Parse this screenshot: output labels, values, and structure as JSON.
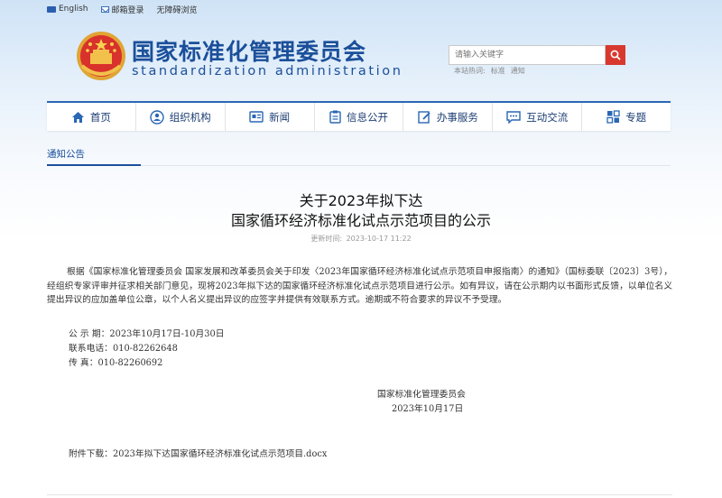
{
  "topbar": {
    "english": "English",
    "mail_login": "邮箱登录",
    "accessible": "无障碍浏览"
  },
  "header": {
    "title": "国家标准化管理委员会",
    "subtitle": "standardization administration"
  },
  "search": {
    "placeholder": "请输入关键字",
    "hot_label": "本站热词:",
    "hot_words": [
      "标准",
      "通知"
    ]
  },
  "nav": {
    "items": [
      {
        "label": "首页",
        "icon": "home-icon"
      },
      {
        "label": "组织机构",
        "icon": "org-icon"
      },
      {
        "label": "新闻",
        "icon": "news-icon"
      },
      {
        "label": "信息公开",
        "icon": "info-icon"
      },
      {
        "label": "办事服务",
        "icon": "service-icon"
      },
      {
        "label": "互动交流",
        "icon": "chat-icon"
      },
      {
        "label": "专题",
        "icon": "topic-icon"
      }
    ]
  },
  "breadcrumb": "通知公告",
  "article": {
    "title_line1": "关于2023年拟下达",
    "title_line2": "国家循环经济标准化试点示范项目的公示",
    "meta_label": "更新时间:",
    "meta_time": "2023-10-17 11:22",
    "paragraph": "根据《国家标准化管理委员会 国家发展和改革委员会关于印发〈2023年国家循环经济标准化试点示范项目申报指南〉的通知》（国标委联〔2023〕3号），经组织专家评审并征求相关部门意见，现将2023年拟下达的国家循环经济标准化试点示范项目进行公示。如有异议，请在公示期内以书面形式反馈，以单位名义提出异议的应加盖单位公章，以个人名义提出异议的应签字并提供有效联系方式。逾期或不符合要求的异议不予受理。",
    "period": "公 示 期：2023年10月17日-10月30日",
    "phone": "联系电话：010-82262648",
    "fax": "传  真：010-82260692",
    "sign_org": "国家标准化管理委员会",
    "sign_date": "2023年10月17日",
    "attach_label": "附件下载：",
    "attach_file": "2023年拟下达国家循环经济标准化试点示范项目.docx"
  },
  "colors": {
    "brand_blue": "#1b4f9a",
    "search_red": "#d8392f",
    "nav_border": "#2a67b4"
  }
}
